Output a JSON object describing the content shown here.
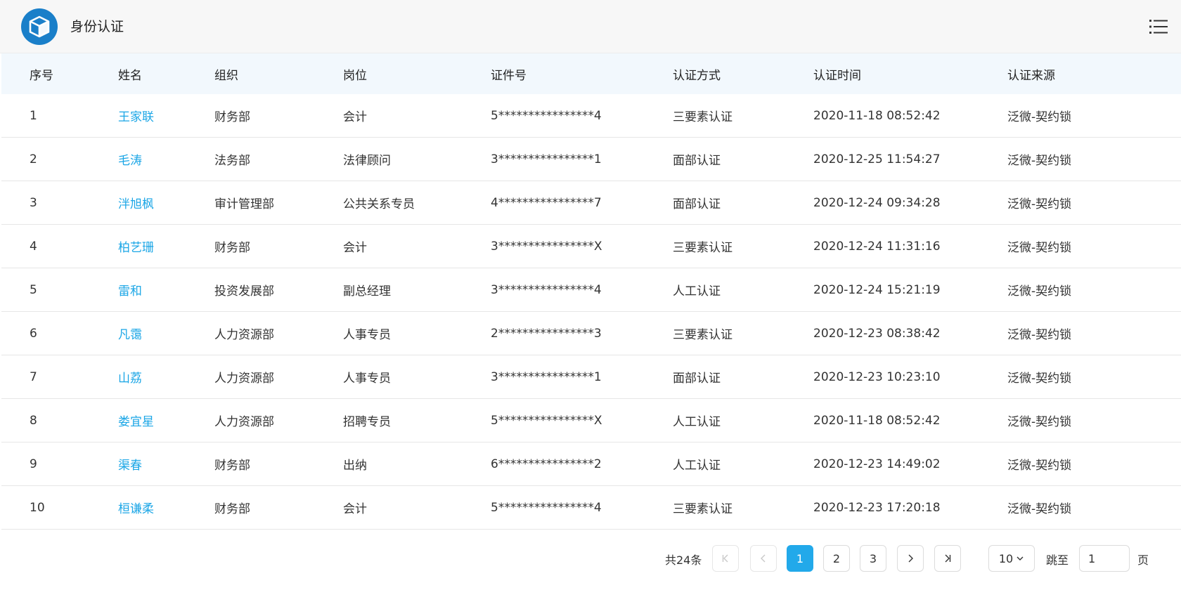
{
  "header": {
    "title": "身份认证",
    "logo_icon": "cube-icon",
    "menu_icon": "list-menu-icon",
    "logo_color": "#1a7fc9"
  },
  "table": {
    "columns": [
      "序号",
      "姓名",
      "组织",
      "岗位",
      "证件号",
      "认证方式",
      "认证时间",
      "认证来源"
    ],
    "rows": [
      {
        "idx": "1",
        "name": "王家联",
        "org": "财务部",
        "pos": "会计",
        "id": "5****************4",
        "method": "三要素认证",
        "time": "2020-11-18 08:52:42",
        "source": "泛微-契约锁"
      },
      {
        "idx": "2",
        "name": "毛涛",
        "org": "法务部",
        "pos": "法律顾问",
        "id": "3****************1",
        "method": "面部认证",
        "time": "2020-12-25 11:54:27",
        "source": "泛微-契约锁"
      },
      {
        "idx": "3",
        "name": "泮旭枫",
        "org": "审计管理部",
        "pos": "公共关系专员",
        "id": "4****************7",
        "method": "面部认证",
        "time": "2020-12-24 09:34:28",
        "source": "泛微-契约锁"
      },
      {
        "idx": "4",
        "name": "柏艺珊",
        "org": "财务部",
        "pos": "会计",
        "id": "3****************X",
        "method": "三要素认证",
        "time": "2020-12-24 11:31:16",
        "source": "泛微-契约锁"
      },
      {
        "idx": "5",
        "name": "雷和",
        "org": "投资发展部",
        "pos": "副总经理",
        "id": "3****************4",
        "method": "人工认证",
        "time": "2020-12-24 15:21:19",
        "source": "泛微-契约锁"
      },
      {
        "idx": "6",
        "name": "凡霭",
        "org": "人力资源部",
        "pos": "人事专员",
        "id": "2****************3",
        "method": "三要素认证",
        "time": "2020-12-23 08:38:42",
        "source": "泛微-契约锁"
      },
      {
        "idx": "7",
        "name": "山荔",
        "org": "人力资源部",
        "pos": "人事专员",
        "id": "3****************1",
        "method": "面部认证",
        "time": "2020-12-23 10:23:10",
        "source": "泛微-契约锁"
      },
      {
        "idx": "8",
        "name": "娄宜星",
        "org": "人力资源部",
        "pos": "招聘专员",
        "id": "5****************X",
        "method": "人工认证",
        "time": "2020-11-18 08:52:42",
        "source": "泛微-契约锁"
      },
      {
        "idx": "9",
        "name": "渠春",
        "org": "财务部",
        "pos": "出纳",
        "id": "6****************2",
        "method": "人工认证",
        "time": "2020-12-23 14:49:02",
        "source": "泛微-契约锁"
      },
      {
        "idx": "10",
        "name": "桓谦柔",
        "org": "财务部",
        "pos": "会计",
        "id": "5****************4",
        "method": "三要素认证",
        "time": "2020-12-23 17:20:18",
        "source": "泛微-契约锁"
      }
    ]
  },
  "pagination": {
    "total_text": "共24条",
    "pages": [
      "1",
      "2",
      "3"
    ],
    "current_page": "1",
    "page_size": "10",
    "goto_label": "跳至",
    "goto_value": "1",
    "page_suffix": "页",
    "accent_color": "#22a9ea"
  }
}
